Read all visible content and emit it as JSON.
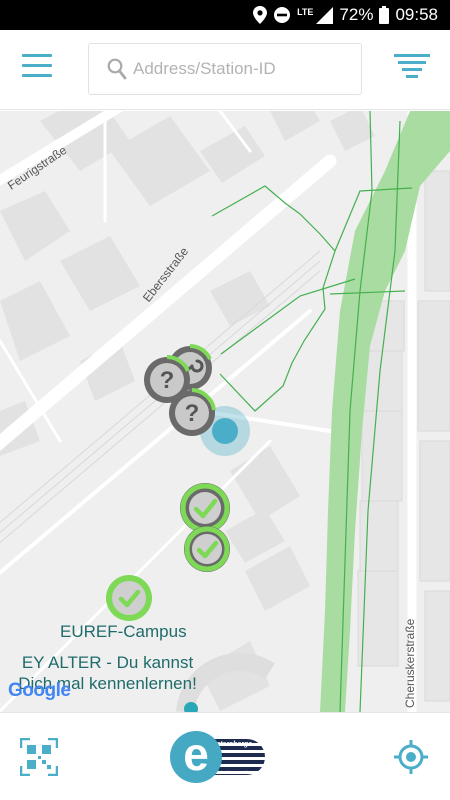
{
  "status_bar": {
    "lte_label": "LTE",
    "battery_percent": "72%",
    "time": "09:58",
    "icons": [
      "location-icon",
      "do-not-disturb-icon",
      "signal-icon",
      "battery-icon"
    ]
  },
  "header": {
    "search_placeholder": "Address/Station-ID",
    "search_value": ""
  },
  "map": {
    "street_labels": [
      "Feurigstraße",
      "Ebersstraße",
      "Cheruskerstraße"
    ],
    "poi_label": "EUREF-Campus",
    "ad_text_line1": "EY ALTER - Du kannst",
    "ad_text_line2": "Dich mal kennenlernen!",
    "attribution": "Google",
    "markers": [
      {
        "status": "unknown",
        "icon": "question-mark-icon",
        "progress": 0.3
      },
      {
        "status": "unknown",
        "icon": "question-mark-icon",
        "progress": 0.4
      },
      {
        "status": "unknown",
        "icon": "question-mark-icon",
        "progress": 0.35
      },
      {
        "status": "available",
        "icon": "checkmark-icon",
        "progress": 1.0
      },
      {
        "status": "available",
        "icon": "checkmark-icon",
        "progress": 1.0
      },
      {
        "status": "available",
        "icon": "checkmark-icon",
        "progress": 1.0
      }
    ]
  },
  "bottom_bar": {
    "logo_word": "intercharge",
    "logo_tagline": "Extend your reach."
  },
  "colors": {
    "accent": "#4aaec8",
    "available_green": "#7ed957",
    "park_green": "#a8dca0",
    "marker_gray": "#707070"
  }
}
